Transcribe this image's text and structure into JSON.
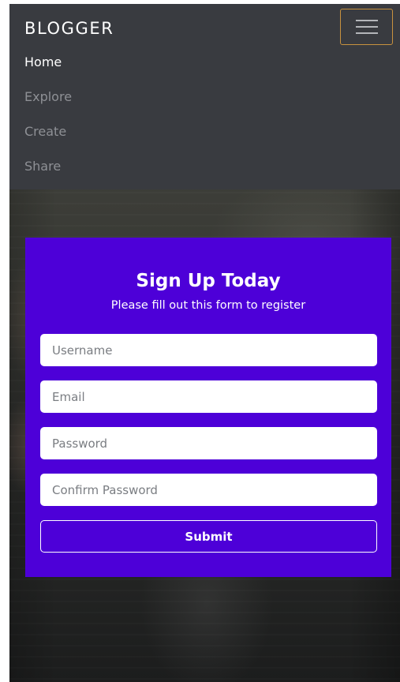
{
  "navbar": {
    "brand": "BLOGGER",
    "toggler_icon": "hamburger-menu-icon",
    "links": [
      {
        "label": "Home",
        "active": true
      },
      {
        "label": "Explore",
        "active": false
      },
      {
        "label": "Create",
        "active": false
      },
      {
        "label": "Share",
        "active": false
      }
    ]
  },
  "signup": {
    "title": "Sign Up Today",
    "subtitle": "Please fill out this form to register",
    "fields": {
      "username_placeholder": "Username",
      "email_placeholder": "Email",
      "password_placeholder": "Password",
      "confirm_placeholder": "Confirm Password"
    },
    "submit_label": "Submit"
  },
  "colors": {
    "navbar_bg": "#393b40",
    "card_bg": "#4d00d8",
    "toggler_border": "#c8923f",
    "nav_link_inactive": "#8e9095",
    "nav_link_active": "#ffffff"
  }
}
